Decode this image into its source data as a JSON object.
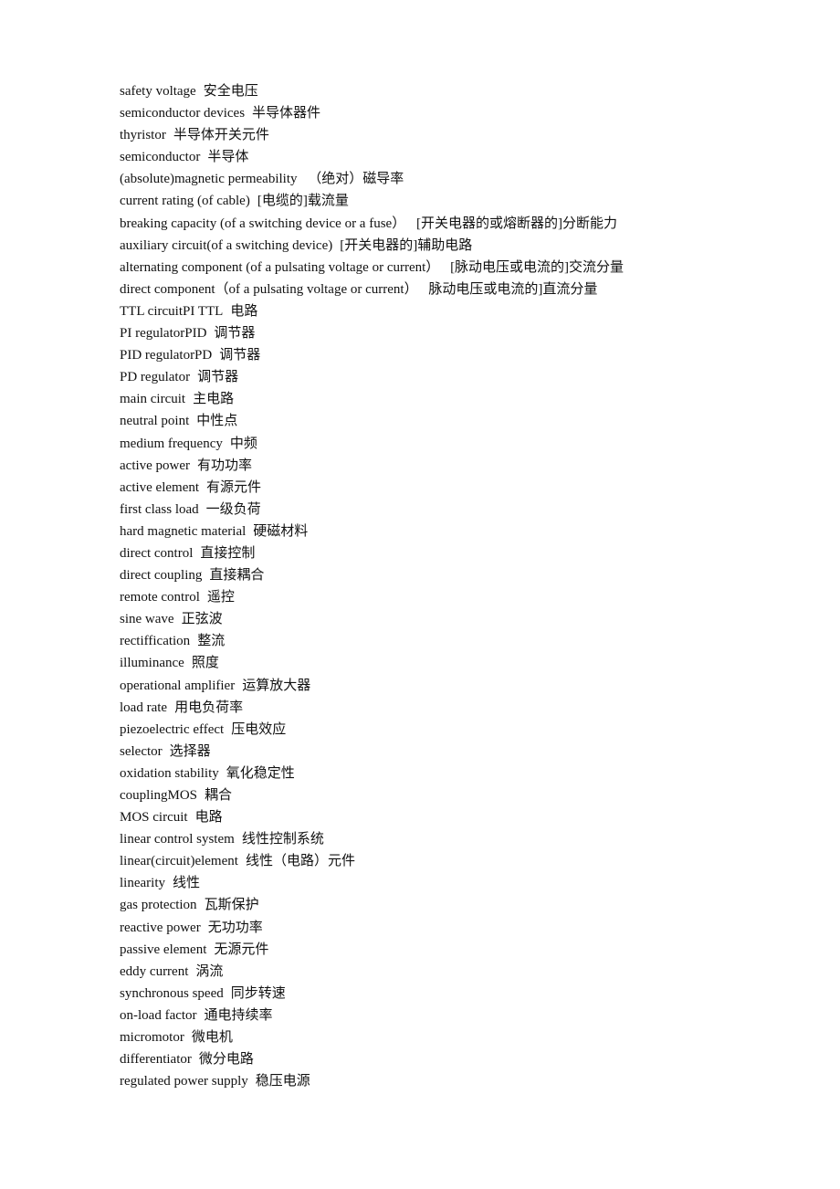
{
  "document": {
    "entries": [
      {
        "en": "safety voltage",
        "zh": "安全电压"
      },
      {
        "en": "semiconductor devices",
        "zh": "半导体器件"
      },
      {
        "en": "thyristor",
        "zh": "半导体开关元件"
      },
      {
        "en": "semiconductor",
        "zh": "半导体"
      },
      {
        "en": "(absolute)magnetic permeability",
        "zh": " （绝对）磁导率"
      },
      {
        "en": "current rating (of cable)",
        "zh": "[电缆的]载流量"
      },
      {
        "en": "breaking capacity (of a switching device or a fuse）",
        "zh": " [开关电器的或熔断器的]分断能力"
      },
      {
        "en": "auxiliary circuit(of a switching device)",
        "zh": "[开关电器的]辅助电路"
      },
      {
        "en": "alternating component (of a pulsating voltage or current）",
        "zh": " [脉动电压或电流的]交流分量"
      },
      {
        "en": "direct component（of a pulsating voltage or current）",
        "zh": " 脉动电压或电流的]直流分量"
      },
      {
        "en": "TTL circuitPI TTL",
        "zh": "电路"
      },
      {
        "en": "PI regulatorPID",
        "zh": "调节器"
      },
      {
        "en": "PID regulatorPD",
        "zh": "调节器"
      },
      {
        "en": "PD regulator",
        "zh": "调节器"
      },
      {
        "en": "main circuit",
        "zh": "主电路"
      },
      {
        "en": "neutral point",
        "zh": "中性点"
      },
      {
        "en": "medium frequency",
        "zh": "中频"
      },
      {
        "en": "active power",
        "zh": "有功功率"
      },
      {
        "en": "active element",
        "zh": "有源元件"
      },
      {
        "en": "first class load",
        "zh": "一级负荷"
      },
      {
        "en": "hard magnetic material",
        "zh": "硬磁材料"
      },
      {
        "en": "direct control",
        "zh": "直接控制"
      },
      {
        "en": "direct coupling",
        "zh": "直接耦合"
      },
      {
        "en": "remote control",
        "zh": "遥控"
      },
      {
        "en": "sine wave",
        "zh": "正弦波"
      },
      {
        "en": "rectiffication",
        "zh": "整流"
      },
      {
        "en": "illuminance",
        "zh": "照度"
      },
      {
        "en": "operational amplifier",
        "zh": "运算放大器"
      },
      {
        "en": "load rate",
        "zh": "用电负荷率"
      },
      {
        "en": "piezoelectric effect",
        "zh": "压电效应"
      },
      {
        "en": "selector",
        "zh": "选择器"
      },
      {
        "en": "oxidation stability",
        "zh": "氧化稳定性"
      },
      {
        "en": "couplingMOS",
        "zh": "耦合"
      },
      {
        "en": "MOS circuit",
        "zh": "电路"
      },
      {
        "en": "linear control system",
        "zh": "线性控制系统"
      },
      {
        "en": "linear(circuit)element",
        "zh": "线性（电路）元件"
      },
      {
        "en": "linearity",
        "zh": "线性"
      },
      {
        "en": "gas protection",
        "zh": "瓦斯保护"
      },
      {
        "en": "reactive power",
        "zh": "无功功率"
      },
      {
        "en": "passive element",
        "zh": "无源元件"
      },
      {
        "en": "eddy current",
        "zh": "涡流"
      },
      {
        "en": "synchronous speed",
        "zh": "同步转速"
      },
      {
        "en": "on-load factor",
        "zh": "通电持续率"
      },
      {
        "en": "micromotor",
        "zh": "微电机"
      },
      {
        "en": "differentiator",
        "zh": "微分电路"
      },
      {
        "en": "regulated power supply",
        "zh": "稳压电源"
      }
    ]
  }
}
